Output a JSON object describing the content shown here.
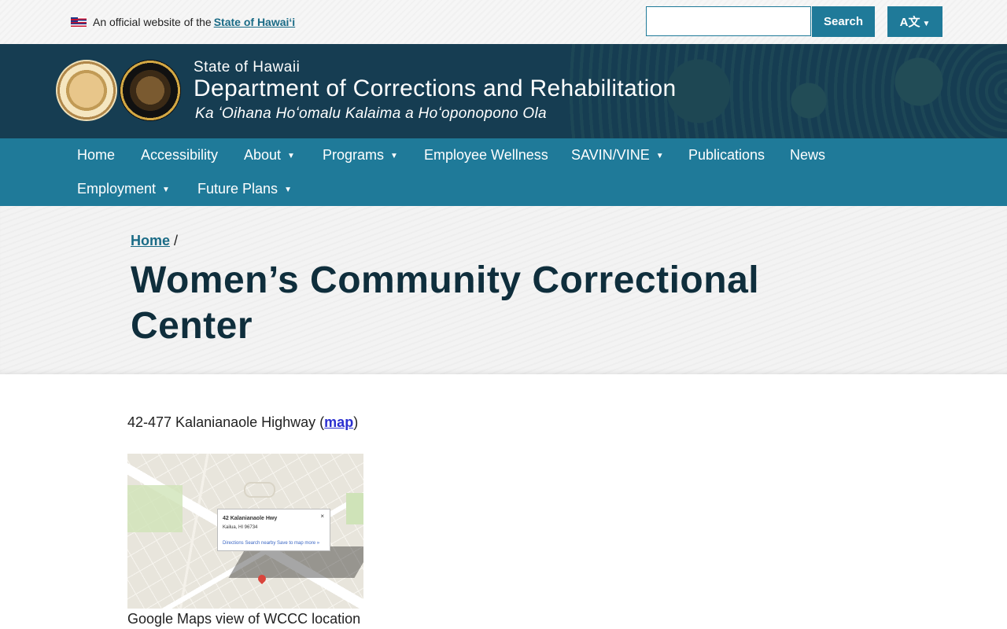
{
  "topbar": {
    "official_text": "An official website of the",
    "official_link": "State of Hawaiʻi",
    "search_placeholder": "",
    "search_button": "Search",
    "lang_button": "A文"
  },
  "header": {
    "state": "State of Hawaii",
    "department": "Department of Corrections and Rehabilitation",
    "hawaiian": "Ka ʻOihana Hoʻomalu Kalaima a Hoʻoponopono Ola"
  },
  "nav": {
    "items": [
      {
        "label": "Home",
        "dropdown": false
      },
      {
        "label": "Accessibility",
        "dropdown": false
      },
      {
        "label": "About",
        "dropdown": true
      },
      {
        "label": "Programs",
        "dropdown": true
      },
      {
        "label": "Employee Wellness",
        "dropdown": false
      },
      {
        "label": "SAVIN/VINE",
        "dropdown": true
      },
      {
        "label": "Publications",
        "dropdown": false
      },
      {
        "label": "News",
        "dropdown": false
      },
      {
        "label": "Employment",
        "dropdown": true
      },
      {
        "label": "Future Plans",
        "dropdown": true
      }
    ]
  },
  "breadcrumb": {
    "home": "Home",
    "separator": "/"
  },
  "page": {
    "title": "Women’s Community Correctional Center",
    "address_text": "42-477 Kalanianaole Highway (",
    "address_link": "map",
    "address_close": ")",
    "map_caption": "Google Maps view of WCCC location",
    "map_popup_title": "42 Kalanianaole Hwy",
    "map_popup_addr": "Kailua, HI 96734",
    "map_popup_links": "Directions   Search nearby   Save to map   more »"
  },
  "colors": {
    "header_bg": "#163d52",
    "nav_bg": "#1f7a99",
    "title_color": "#0f2e3c",
    "link": "#1a6b86"
  }
}
